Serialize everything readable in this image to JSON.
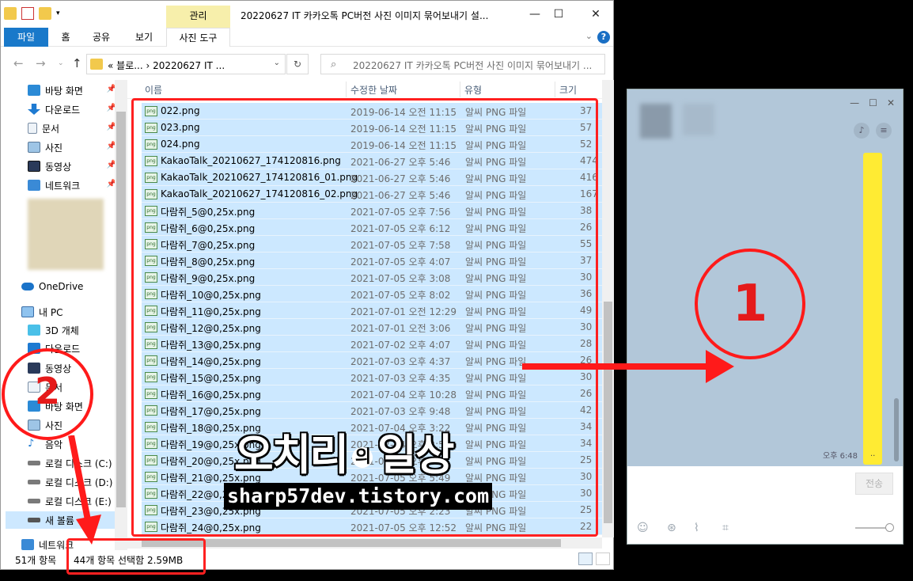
{
  "explorer": {
    "title": "20220627 IT 카카오톡 PC버전 사진 이미지 묶어보내기 설...",
    "context_tab": "관리",
    "ribbon_tabs": [
      "파일",
      "홈",
      "공유",
      "보기",
      "사진 도구"
    ],
    "address": "« 블로... › 20220627 IT ...",
    "search_placeholder": "20220627 IT 카카오톡 PC버전 사진 이미지 묶어보내기 ...",
    "columns": [
      "이름",
      "수정한 날짜",
      "유형",
      "크기"
    ],
    "sidebar_quick": [
      "바탕 화면",
      "다운로드",
      "문서",
      "사진",
      "동영상",
      "네트워크"
    ],
    "onedrive": "OneDrive",
    "this_pc": "내 PC",
    "sidebar_pc": [
      "3D 개체",
      "다운로드",
      "동영상",
      "문서",
      "바탕 화면",
      "사진",
      "음악",
      "로컬 디스크 (C:)",
      "로컬 디스크 (D:)",
      "로컬 디스크 (E:)",
      "새 볼륨"
    ],
    "network_bottom": "네트워크",
    "files": [
      {
        "name": "022.png",
        "date": "2019-06-14 오전 11:15",
        "type": "알씨 PNG 파일",
        "size": "37"
      },
      {
        "name": "023.png",
        "date": "2019-06-14 오전 11:15",
        "type": "알씨 PNG 파일",
        "size": "57"
      },
      {
        "name": "024.png",
        "date": "2019-06-14 오전 11:15",
        "type": "알씨 PNG 파일",
        "size": "52"
      },
      {
        "name": "KakaoTalk_20210627_174120816.png",
        "date": "2021-06-27 오후 5:46",
        "type": "알씨 PNG 파일",
        "size": "474"
      },
      {
        "name": "KakaoTalk_20210627_174120816_01.png",
        "date": "2021-06-27 오후 5:46",
        "type": "알씨 PNG 파일",
        "size": "416"
      },
      {
        "name": "KakaoTalk_20210627_174120816_02.png",
        "date": "2021-06-27 오후 5:46",
        "type": "알씨 PNG 파일",
        "size": "167"
      },
      {
        "name": "다람쥐_5@0,25x.png",
        "date": "2021-07-05 오후 7:56",
        "type": "알씨 PNG 파일",
        "size": "38"
      },
      {
        "name": "다람쥐_6@0,25x.png",
        "date": "2021-07-05 오후 6:12",
        "type": "알씨 PNG 파일",
        "size": "26"
      },
      {
        "name": "다람쥐_7@0,25x.png",
        "date": "2021-07-05 오후 7:58",
        "type": "알씨 PNG 파일",
        "size": "55"
      },
      {
        "name": "다람쥐_8@0,25x.png",
        "date": "2021-07-05 오후 4:07",
        "type": "알씨 PNG 파일",
        "size": "37"
      },
      {
        "name": "다람쥐_9@0,25x.png",
        "date": "2021-07-05 오후 3:08",
        "type": "알씨 PNG 파일",
        "size": "30"
      },
      {
        "name": "다람쥐_10@0,25x.png",
        "date": "2021-07-05 오후 8:02",
        "type": "알씨 PNG 파일",
        "size": "36"
      },
      {
        "name": "다람쥐_11@0,25x.png",
        "date": "2021-07-01 오전 12:29",
        "type": "알씨 PNG 파일",
        "size": "49"
      },
      {
        "name": "다람쥐_12@0,25x.png",
        "date": "2021-07-01 오전 3:06",
        "type": "알씨 PNG 파일",
        "size": "30"
      },
      {
        "name": "다람쥐_13@0,25x.png",
        "date": "2021-07-02 오후 4:07",
        "type": "알씨 PNG 파일",
        "size": "28"
      },
      {
        "name": "다람쥐_14@0,25x.png",
        "date": "2021-07-03 오후 4:37",
        "type": "알씨 PNG 파일",
        "size": "26"
      },
      {
        "name": "다람쥐_15@0,25x.png",
        "date": "2021-07-03 오후 4:35",
        "type": "알씨 PNG 파일",
        "size": "30"
      },
      {
        "name": "다람쥐_16@0,25x.png",
        "date": "2021-07-04 오후 10:28",
        "type": "알씨 PNG 파일",
        "size": "26"
      },
      {
        "name": "다람쥐_17@0,25x.png",
        "date": "2021-07-03 오후 9:48",
        "type": "알씨 PNG 파일",
        "size": "42"
      },
      {
        "name": "다람쥐_18@0,25x.png",
        "date": "2021-07-04 오후 3:22",
        "type": "알씨 PNG 파일",
        "size": "34"
      },
      {
        "name": "다람쥐_19@0,25x.png",
        "date": "2021-07-04 오후 2:58",
        "type": "알씨 PNG 파일",
        "size": "34"
      },
      {
        "name": "다람쥐_20@0,25x.png",
        "date": "2021-07-04 오후 5:11",
        "type": "알씨 PNG 파일",
        "size": "25"
      },
      {
        "name": "다람쥐_21@0,25x.png",
        "date": "2021-07-05 오후 5:49",
        "type": "알씨 PNG 파일",
        "size": "30"
      },
      {
        "name": "다람쥐_22@0,25x.png",
        "date": "2021-07-05 오후 1:44",
        "type": "알씨 PNG 파일",
        "size": "30"
      },
      {
        "name": "다람쥐_23@0,25x.png",
        "date": "2021-07-05 오후 2:23",
        "type": "알씨 PNG 파일",
        "size": "25"
      },
      {
        "name": "다람쥐_24@0,25x.png",
        "date": "2021-07-05 오후 12:52",
        "type": "알씨 PNG 파일",
        "size": "22"
      }
    ],
    "status_count": "51개 항목",
    "status_selected": "44개 항목 선택함 2.59MB"
  },
  "chat": {
    "time": "오후 6:48",
    "bubble_text": "..",
    "send_label": "전송"
  },
  "annotations": {
    "label_1": "1",
    "label_2": "2"
  },
  "watermark": {
    "title_a": "오치리",
    "title_of": "의",
    "title_b": "일상",
    "url": "sharp57dev.tistory.com"
  },
  "colors": {
    "selection": "#cce8ff",
    "annotation_red": "#ff1a1a",
    "kakao_yellow": "#ffeb33",
    "chat_bg": "#b2c7d9"
  }
}
